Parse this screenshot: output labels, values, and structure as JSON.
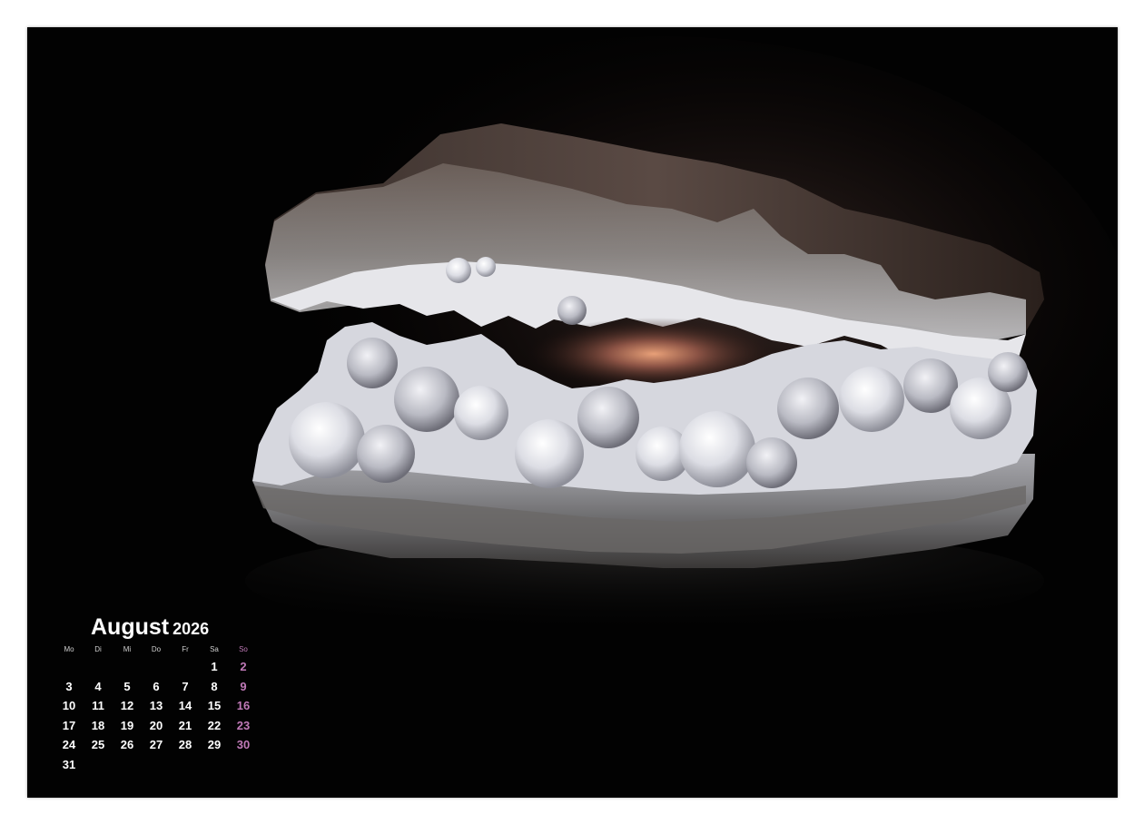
{
  "calendar": {
    "month": "August",
    "year": "2026",
    "weekdays": [
      "Mo",
      "Di",
      "Mi",
      "Do",
      "Fr",
      "Sa",
      "So"
    ],
    "weeks": [
      [
        "",
        "",
        "",
        "",
        "",
        "1",
        "2"
      ],
      [
        "3",
        "4",
        "5",
        "6",
        "7",
        "8",
        "9"
      ],
      [
        "10",
        "11",
        "12",
        "13",
        "14",
        "15",
        "16"
      ],
      [
        "17",
        "18",
        "19",
        "20",
        "21",
        "22",
        "23"
      ],
      [
        "24",
        "25",
        "26",
        "27",
        "28",
        "29",
        "30"
      ],
      [
        "31",
        "",
        "",
        "",
        "",
        "",
        ""
      ]
    ]
  },
  "colors": {
    "background": "#020202",
    "paper": "#ffffff",
    "text": "#ffffff",
    "sunday": "#c07ab8"
  },
  "photo": {
    "subject": "mineral-geode"
  }
}
